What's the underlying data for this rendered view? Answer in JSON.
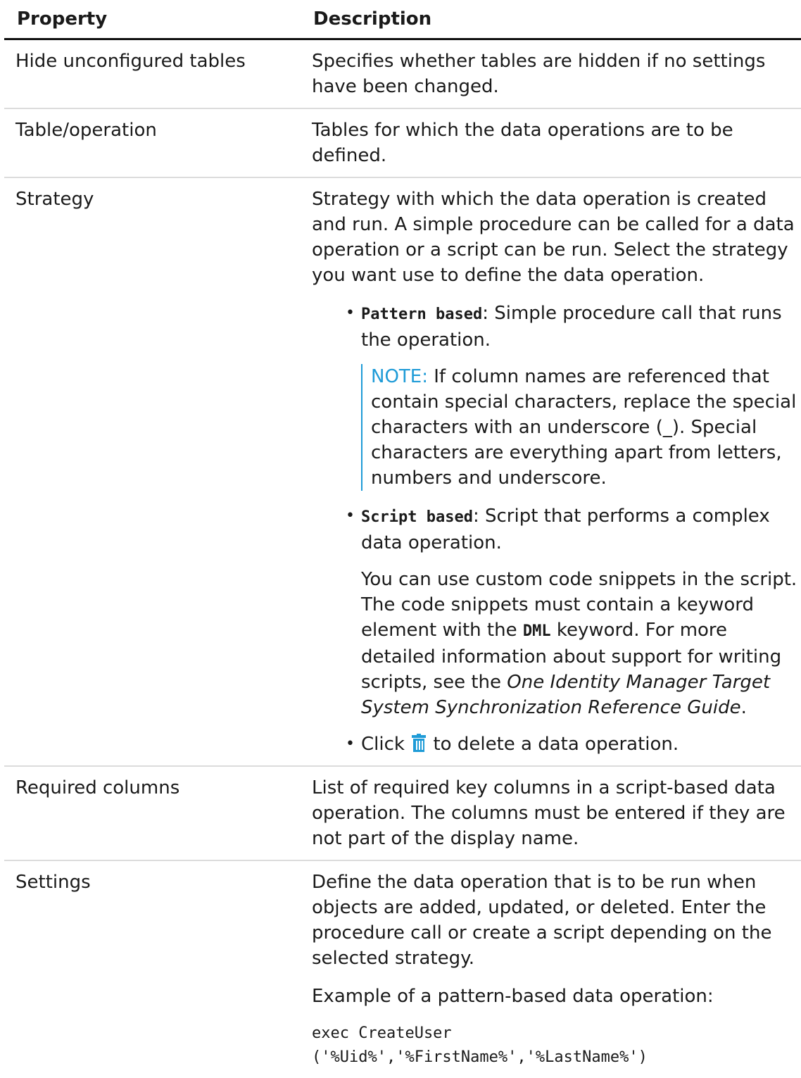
{
  "header": {
    "property": "Property",
    "description": "Description"
  },
  "rows": [
    {
      "property": "Hide unconfigured tables",
      "description": "Specifies whether tables are hidden if no settings have been changed."
    },
    {
      "property": "Table/operation",
      "description": "Tables for which the data operations are to be defined."
    },
    {
      "property": "Strategy",
      "intro": "Strategy with which the data operation is created and run. A simple procedure can be called for a data operation or a script can be run. Select the strategy you want use to define the data operation.",
      "bullets": [
        {
          "term": "Pattern based",
          "text": ": Simple procedure call that runs the operation."
        },
        {
          "term": "Script based",
          "text": ": Script that performs a complex data operation."
        },
        {
          "before": "Click",
          "icon": "trash-icon",
          "after": "to delete a data operation."
        }
      ],
      "note": {
        "label": "NOTE:",
        "text": " If column names are referenced that contain special characters, replace the special characters with an underscore (_). Special characters are everything apart from letters, numbers and underscore."
      },
      "script_detail": {
        "t1": "You can use custom code snippets in the script. The code snippets must contain a keyword element with the ",
        "keyword": "DML",
        "t2": " keyword. For more detailed information about support for writing scripts, see the ",
        "guide": "One Identity Manager Target System Synchronization Reference Guide",
        "t3": "."
      }
    },
    {
      "property": "Required columns",
      "description": "List of required key columns in a script-based data operation. The columns must be entered if they are not part of the display name."
    },
    {
      "property": "Settings",
      "description": "Define the data operation that is to be run when objects are added, updated, or deleted. Enter the procedure call or create a script depending on the selected strategy.",
      "example_label": "Example of a pattern-based data operation:",
      "code": "exec CreateUser\n('%Uid%','%FirstName%','%LastName%')"
    }
  ]
}
